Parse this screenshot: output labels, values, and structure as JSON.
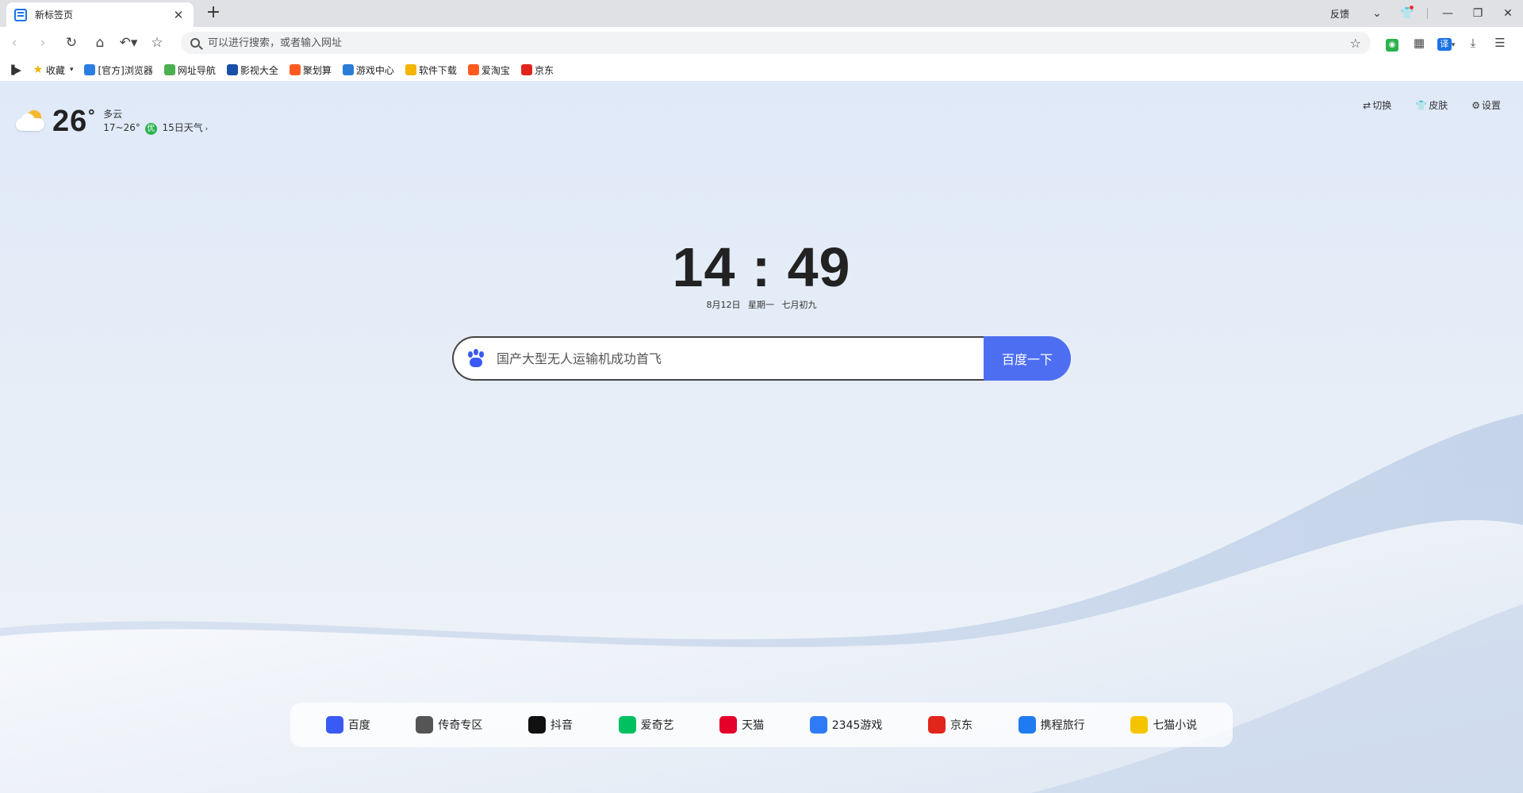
{
  "tab": {
    "title": "新标签页"
  },
  "window": {
    "feedback": "反馈"
  },
  "omnibox": {
    "placeholder": "可以进行搜索，或者输入网址"
  },
  "toolbar": {
    "translate_label": "译"
  },
  "bookmarks": {
    "favorites_label": "收藏",
    "items": [
      {
        "label": "[官方]浏览器",
        "icon": "browser-icon",
        "color": "#2a7de1"
      },
      {
        "label": "网址导航",
        "icon": "home-nav-icon",
        "color": "#4caf50"
      },
      {
        "label": "影视大全",
        "icon": "video-icon",
        "color": "#1a4fa8"
      },
      {
        "label": "聚划算",
        "icon": "ju-icon",
        "color": "#ff5a1f"
      },
      {
        "label": "游戏中心",
        "icon": "game-center-icon",
        "color": "#2b7bd8"
      },
      {
        "label": "软件下载",
        "icon": "software-icon",
        "color": "#f4b400"
      },
      {
        "label": "爱淘宝",
        "icon": "taobao-icon",
        "color": "#ff5a1f"
      },
      {
        "label": "京东",
        "icon": "jd-icon",
        "color": "#e1251b"
      }
    ]
  },
  "weather": {
    "temp": "26",
    "degree": "°",
    "condition": "多云",
    "range": "17~26°",
    "aqi": "优",
    "forecast": "15日天气"
  },
  "corner": {
    "switch": "切换",
    "skin": "皮肤",
    "settings": "设置"
  },
  "clock": {
    "time": "14 : 49",
    "date": "8月12日",
    "weekday": "星期一",
    "lunar": "七月初九"
  },
  "search": {
    "placeholder": "国产大型无人运输机成功首飞",
    "button": "百度一下"
  },
  "shortcuts": [
    {
      "label": "百度",
      "icon": "baidu-icon",
      "color": "#3a5af5"
    },
    {
      "label": "传奇专区",
      "icon": "legend-icon",
      "color": "#555555"
    },
    {
      "label": "抖音",
      "icon": "douyin-icon",
      "color": "#111111"
    },
    {
      "label": "爱奇艺",
      "icon": "iqiyi-icon",
      "color": "#00c060"
    },
    {
      "label": "天猫",
      "icon": "tmall-icon",
      "color": "#e4002b"
    },
    {
      "label": "2345游戏",
      "icon": "gamepad-icon",
      "color": "#2f7bf5"
    },
    {
      "label": "京东",
      "icon": "jd-icon",
      "color": "#e1251b"
    },
    {
      "label": "携程旅行",
      "icon": "ctrip-icon",
      "color": "#1f7bf0"
    },
    {
      "label": "七猫小说",
      "icon": "qimao-icon",
      "color": "#f5c400"
    }
  ]
}
